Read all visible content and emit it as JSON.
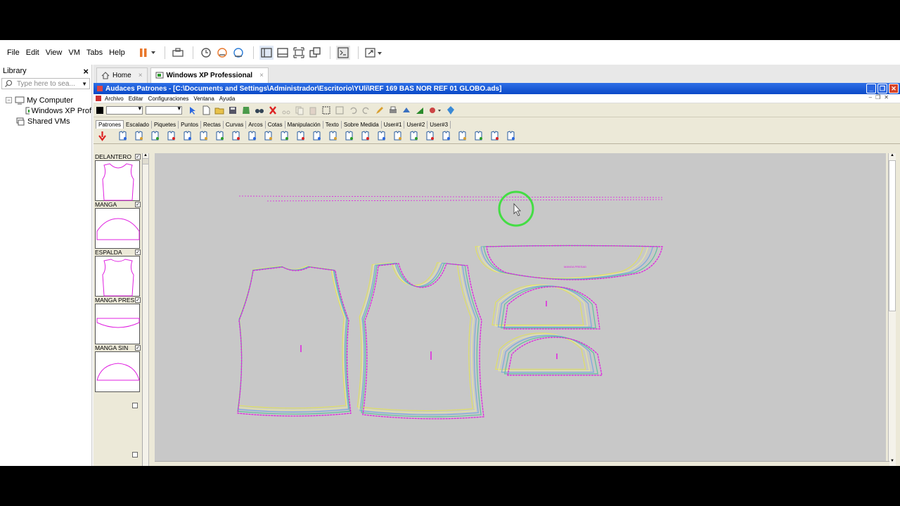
{
  "vmware": {
    "menu": [
      "File",
      "Edit",
      "View",
      "VM",
      "Tabs",
      "Help"
    ],
    "library_title": "Library",
    "search_placeholder": "Type here to sea...",
    "tree": {
      "my_computer": "My Computer",
      "vm_item": "Windows XP Prof",
      "shared": "Shared VMs"
    },
    "tabs": [
      {
        "label": "Home"
      },
      {
        "label": "Windows XP Professional"
      }
    ]
  },
  "app": {
    "title": "Audaces Patrones - [C:\\Documents and Settings\\Administrador\\Escritorio\\YUli\\REF 169 BAS NOR REF 01 GLOBO.ads]",
    "menu": [
      "Archivo",
      "Editar",
      "Configuraciones",
      "Ventana",
      "Ayuda"
    ],
    "tabs": [
      "Patrones",
      "Escalado",
      "Piquetes",
      "Puntos",
      "Rectas",
      "Curvas",
      "Arcos",
      "Cotas",
      "Manipulación",
      "Texto",
      "Sobre Medida",
      "User#1",
      "User#2",
      "User#3"
    ],
    "active_tab": "Patrones",
    "pieces": [
      {
        "label": "DELANTERO"
      },
      {
        "label": "MANGA"
      },
      {
        "label": "ESPALDA"
      },
      {
        "label": "MANGA PRES"
      },
      {
        "label": "MANGA SIN"
      }
    ],
    "canvas_piece_text": "MANGA PRESAD",
    "colors": {
      "xp_title": "#0a49c8",
      "pattern_outline": "#e020e0",
      "canvas_bg": "#c8c8c8",
      "cursor_ring": "#44dd44"
    }
  }
}
